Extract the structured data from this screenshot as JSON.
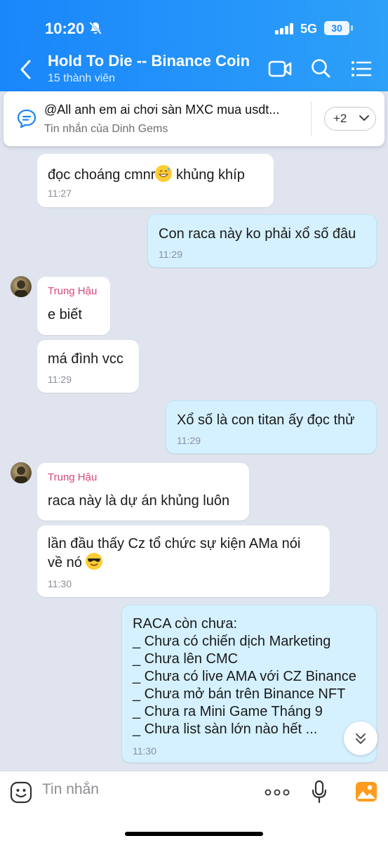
{
  "status_bar": {
    "time": "10:20",
    "network": "5G",
    "battery": "30"
  },
  "header": {
    "title": "Hold To Die -- Binance Coin",
    "subtitle": "15 thành viên"
  },
  "pinned": {
    "text": "@All  anh em ai chơi sàn MXC mua usdt...",
    "sub": "Tin nhắn của Dinh Gems",
    "more": "+2"
  },
  "messages": [
    {
      "text": "đọc choáng cmnr",
      "text_after": " khủng khíp",
      "time": "11:27"
    },
    {
      "text": "Con raca này ko phải xổ số đâu",
      "time": "11:29"
    },
    {
      "sender": "Trung Hậu",
      "text": "e biết"
    },
    {
      "text": "má đình vcc",
      "time": "11:29"
    },
    {
      "text": "Xổ số là con titan ấy đọc thử",
      "time": "11:29"
    },
    {
      "sender": "Trung Hậu",
      "text": "raca này là dự án khủng luôn"
    },
    {
      "line1": "lần đầu thấy Cz tổ chức sự kiện AMa nói",
      "line2": "về nó ",
      "time": "11:30"
    },
    {
      "lines": [
        "RACA còn chưa:",
        "_ Chưa có chiến dịch Marketing",
        "_ Chưa lên CMC",
        "_ Chưa có live AMA với CZ Binance",
        "_ Chưa mở bán trên Binance NFT",
        "_ Chưa ra Mini Game Tháng 9",
        "_ Chưa list sàn lớn nào hết ..."
      ],
      "time": "11:30"
    }
  ],
  "composer": {
    "placeholder": "Tin nhắn"
  },
  "colors": {
    "header": "#1a86fb",
    "my_bubble": "#d5f1ff",
    "sender_name": "#d9487c",
    "background": "#dfe4ee"
  }
}
